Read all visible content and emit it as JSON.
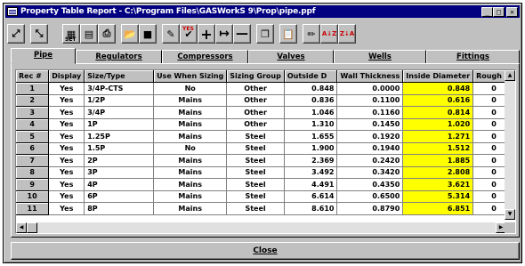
{
  "window": {
    "title": "Property Table Report - C:\\Program Files\\GASWorkS 9\\Prop\\pipe.ppf",
    "minimize": "_",
    "maximize": "□",
    "close": "✕"
  },
  "toolbar": {
    "buttons": [
      {
        "name": "zoom-in-icon",
        "glyph": "⤢"
      },
      {
        "name": "zoom-out-icon",
        "glyph": "⤡"
      },
      {
        "name": "set-icon",
        "glyph": "▦",
        "caption": "SET"
      },
      {
        "name": "table-layout-icon",
        "glyph": "▤"
      },
      {
        "name": "print-icon",
        "glyph": "⎙"
      },
      {
        "name": "open-folder-icon",
        "glyph": "📂"
      },
      {
        "name": "save-icon",
        "glyph": "■"
      },
      {
        "name": "mark-icon",
        "glyph": "✎"
      },
      {
        "name": "mark-yes-icon",
        "glyph": "✔",
        "caption": "YES"
      },
      {
        "name": "add-icon",
        "glyph": "+"
      },
      {
        "name": "insert-icon",
        "glyph": "↦"
      },
      {
        "name": "delete-icon",
        "glyph": "—"
      },
      {
        "name": "copy-icon",
        "glyph": "❐"
      },
      {
        "name": "paste-icon",
        "glyph": "📋"
      },
      {
        "name": "edit-icon",
        "glyph": "✏"
      },
      {
        "name": "sort-ascending-icon",
        "glyph": "A↓Z"
      },
      {
        "name": "sort-descending-icon",
        "glyph": "Z↓A"
      }
    ]
  },
  "tabs": [
    {
      "label": "Pipe",
      "active": true
    },
    {
      "label": "Regulators"
    },
    {
      "label": "Compressors"
    },
    {
      "label": "Valves"
    },
    {
      "label": "Wells"
    },
    {
      "label": "Fittings"
    }
  ],
  "grid": {
    "columns": [
      "Rec #",
      "Display",
      "Size/Type",
      "Use When Sizing",
      "Sizing Group",
      "Outside D",
      "Wall Thickness",
      "Inside Diameter",
      "Rough"
    ],
    "rows": [
      [
        "1",
        "Yes",
        "3/4P-CTS",
        "No",
        "Other",
        "0.848",
        "0.0000",
        "0.848",
        "0"
      ],
      [
        "2",
        "Yes",
        "1/2P",
        "Mains",
        "Other",
        "0.836",
        "0.1100",
        "0.616",
        "0"
      ],
      [
        "3",
        "Yes",
        "3/4P",
        "Mains",
        "Other",
        "1.046",
        "0.1160",
        "0.814",
        "0"
      ],
      [
        "4",
        "Yes",
        "1P",
        "Mains",
        "Other",
        "1.310",
        "0.1450",
        "1.020",
        "0"
      ],
      [
        "5",
        "Yes",
        "1.25P",
        "Mains",
        "Steel",
        "1.655",
        "0.1920",
        "1.271",
        "0"
      ],
      [
        "6",
        "Yes",
        "1.5P",
        "No",
        "Steel",
        "1.900",
        "0.1940",
        "1.512",
        "0"
      ],
      [
        "7",
        "Yes",
        "2P",
        "Mains",
        "Steel",
        "2.369",
        "0.2420",
        "1.885",
        "0"
      ],
      [
        "8",
        "Yes",
        "3P",
        "Mains",
        "Steel",
        "3.492",
        "0.3420",
        "2.808",
        "0"
      ],
      [
        "9",
        "Yes",
        "4P",
        "Mains",
        "Steel",
        "4.491",
        "0.4350",
        "3.621",
        "0"
      ],
      [
        "10",
        "Yes",
        "6P",
        "Mains",
        "Steel",
        "6.614",
        "0.6500",
        "5.314",
        "0"
      ],
      [
        "11",
        "Yes",
        "8P",
        "Mains",
        "Steel",
        "8.610",
        "0.8790",
        "6.851",
        "0"
      ]
    ]
  },
  "close_button": "Close",
  "colors": {
    "highlight": "#ffff00",
    "titlebar": "#000080",
    "face": "#c0c0c0"
  }
}
